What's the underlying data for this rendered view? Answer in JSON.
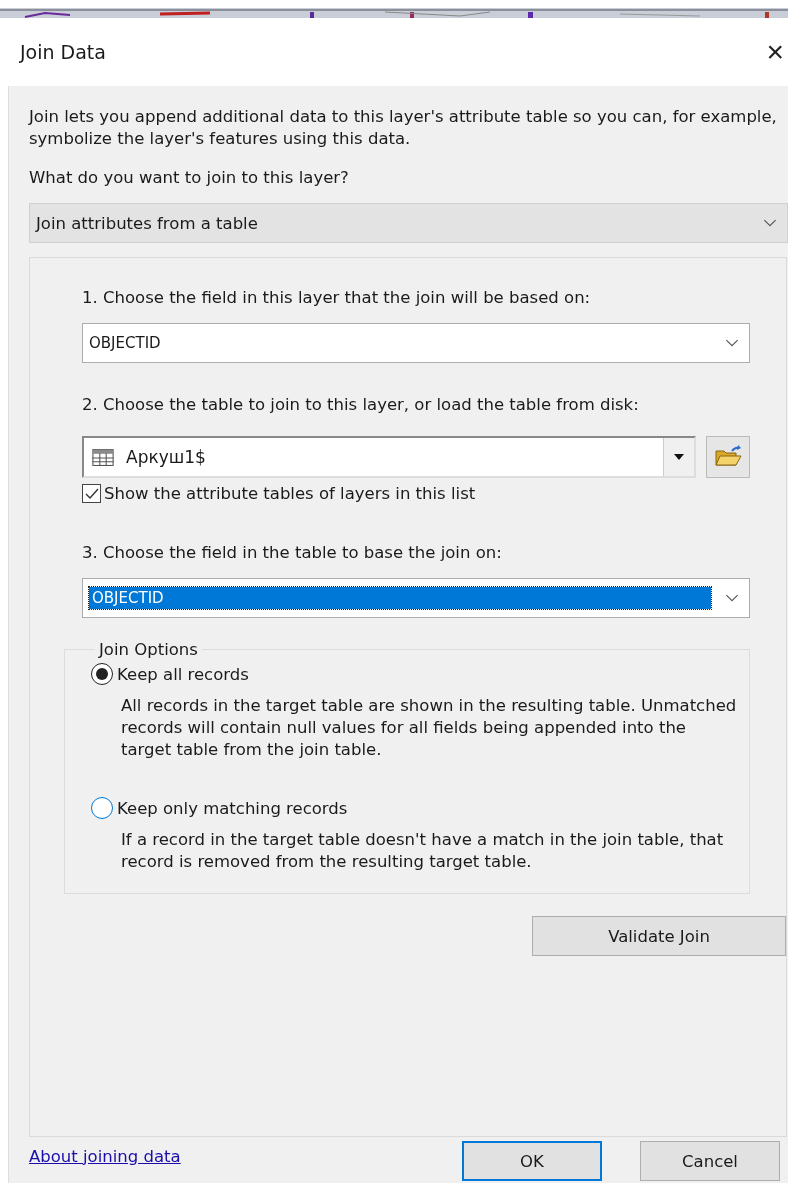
{
  "window": {
    "title": "Join Data",
    "close": "×"
  },
  "intro": "Join lets you append additional data to this layer's attribute table so you can, for example, symbolize the layer's features using this data.",
  "question": "What do you want to join to this layer?",
  "join_type": {
    "value": "Join attributes from a table"
  },
  "step_1": {
    "label": "1. Choose the field in this layer that the join will be based on:",
    "value": "OBJECTID"
  },
  "step_2": {
    "label": "2. Choose the table to join to this layer, or load the table from disk:",
    "value": "Аркуш1$",
    "show_layers": {
      "label": "Show the attribute tables of layers in this list",
      "checked": true
    }
  },
  "step_3": {
    "label": "3. Choose the field in the table to base the join on:",
    "value": "OBJECTID",
    "highlighted": true
  },
  "join_options": {
    "title": "Join Options",
    "options": [
      {
        "label": "Keep all records",
        "selected": true,
        "description": "All records in the target table are shown in the resulting table. Unmatched records will contain null values for all fields being appended into the target table from the join table."
      },
      {
        "label": "Keep only matching records",
        "selected": false,
        "description": "If a record in the target table doesn't have a match in the join table, that record is removed from the resulting target table."
      }
    ]
  },
  "validate_button": "Validate Join",
  "help_link": "About joining data",
  "buttons": [
    {
      "label": "OK",
      "default": true
    },
    {
      "label": "Cancel",
      "default": false
    }
  ]
}
